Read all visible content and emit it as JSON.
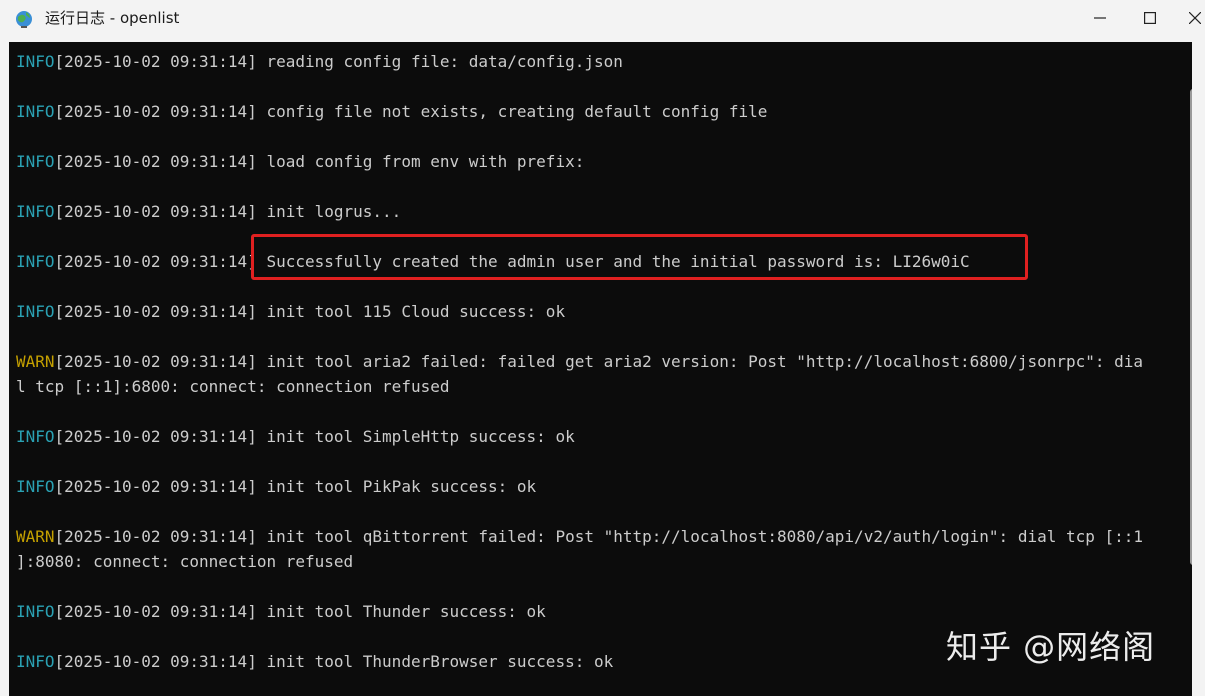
{
  "window": {
    "title": "运行日志 - openlist",
    "icon": "app-globe-icon",
    "controls": [
      "minimize-icon",
      "maximize-icon",
      "close-icon"
    ]
  },
  "colors": {
    "info": "#2aa1b3",
    "warn": "#c4a000",
    "text": "#cccccc",
    "console_bg": "#0c0c0c",
    "highlight": "#e02020"
  },
  "log": [
    {
      "level": "INFO",
      "lines": [
        "[2025-10-02 09:31:14] reading config file: data/config.json"
      ]
    },
    {
      "level": "INFO",
      "lines": [
        "[2025-10-02 09:31:14] config file not exists, creating default config file"
      ]
    },
    {
      "level": "INFO",
      "lines": [
        "[2025-10-02 09:31:14] load config from env with prefix:"
      ]
    },
    {
      "level": "INFO",
      "lines": [
        "[2025-10-02 09:31:14] init logrus..."
      ]
    },
    {
      "level": "INFO",
      "lines": [
        "[2025-10-02 09:31:14] Successfully created the admin user and the initial password is: LI26w0iC"
      ]
    },
    {
      "level": "INFO",
      "lines": [
        "[2025-10-02 09:31:14] init tool 115 Cloud success: ok"
      ]
    },
    {
      "level": "WARN",
      "lines": [
        "[2025-10-02 09:31:14] init tool aria2 failed: failed get aria2 version: Post \"http://localhost:6800/jsonrpc\": dia",
        "l tcp [::1]:6800: connect: connection refused"
      ]
    },
    {
      "level": "INFO",
      "lines": [
        "[2025-10-02 09:31:14] init tool SimpleHttp success: ok"
      ]
    },
    {
      "level": "INFO",
      "lines": [
        "[2025-10-02 09:31:14] init tool PikPak success: ok"
      ]
    },
    {
      "level": "WARN",
      "lines": [
        "[2025-10-02 09:31:14] init tool qBittorrent failed: Post \"http://localhost:8080/api/v2/auth/login\": dial tcp [::1",
        "]:8080: connect: connection refused"
      ]
    },
    {
      "level": "INFO",
      "lines": [
        "[2025-10-02 09:31:14] init tool Thunder success: ok"
      ]
    },
    {
      "level": "INFO",
      "lines": [
        "[2025-10-02 09:31:14] init tool ThunderBrowser success: ok"
      ]
    }
  ],
  "watermark": "知乎 @网络阁"
}
